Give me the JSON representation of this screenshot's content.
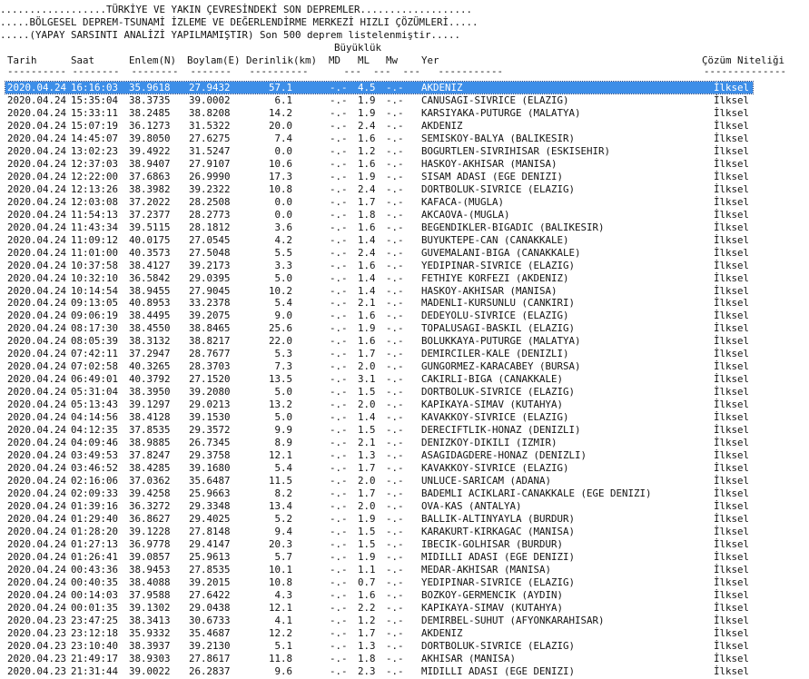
{
  "header": {
    "line1": "..................TÜRKİYE VE YAKIN ÇEVRESİNDEKİ SON DEPREMLER...................",
    "line2": ".....BÖLGESEL DEPREM-TSUNAMİ İZLEME VE DEĞERLENDİRME MERKEZİ HIZLI ÇÖZÜMLERİ.....",
    "line3": ".....(YAPAY SARSINTI ANALİZİ YAPILMAMIŞTIR) Son 500 deprem listelenmiştir.....",
    "magnitude_group": "Büyüklük"
  },
  "columns": {
    "date": "Tarih",
    "time": "Saat",
    "lat": "Enlem(N)",
    "lon": "Boylam(E)",
    "depth": "Derinlik(km)",
    "md": "MD",
    "ml": "ML",
    "mw": "Mw",
    "place": "Yer",
    "quality": "Çözüm Niteliği"
  },
  "colors": {
    "selection": "#3d8ee8",
    "text": "#111111"
  },
  "rows": [
    {
      "date": "2020.04.24",
      "time": "16:16:03",
      "lat": "35.9618",
      "lon": "27.9432",
      "depth": "57.1",
      "md": "-.-",
      "ml": "4.5",
      "mw": "-.-",
      "place": "AKDENIZ",
      "quality": "İlksel"
    },
    {
      "date": "2020.04.24",
      "time": "15:35:04",
      "lat": "38.3735",
      "lon": "39.0002",
      "depth": "6.1",
      "md": "-.-",
      "ml": "1.9",
      "mw": "-.-",
      "place": "CANUSAGI-SIVRICE (ELAZIG)",
      "quality": "İlksel"
    },
    {
      "date": "2020.04.24",
      "time": "15:33:11",
      "lat": "38.2485",
      "lon": "38.8208",
      "depth": "14.2",
      "md": "-.-",
      "ml": "1.9",
      "mw": "-.-",
      "place": "KARSIYAKA-PUTURGE (MALATYA)",
      "quality": "İlksel"
    },
    {
      "date": "2020.04.24",
      "time": "15:07:19",
      "lat": "36.1273",
      "lon": "31.5322",
      "depth": "20.0",
      "md": "-.-",
      "ml": "2.4",
      "mw": "-.-",
      "place": "AKDENIZ",
      "quality": "İlksel"
    },
    {
      "date": "2020.04.24",
      "time": "14:45:07",
      "lat": "39.8050",
      "lon": "27.6275",
      "depth": "7.4",
      "md": "-.-",
      "ml": "1.6",
      "mw": "-.-",
      "place": "SEMISKOY-BALYA (BALIKESIR)",
      "quality": "İlksel"
    },
    {
      "date": "2020.04.24",
      "time": "13:02:23",
      "lat": "39.4922",
      "lon": "31.5247",
      "depth": "0.0",
      "md": "-.-",
      "ml": "1.2",
      "mw": "-.-",
      "place": "BOGURTLEN-SIVRIHISAR (ESKISEHIR)",
      "quality": "İlksel"
    },
    {
      "date": "2020.04.24",
      "time": "12:37:03",
      "lat": "38.9407",
      "lon": "27.9107",
      "depth": "10.6",
      "md": "-.-",
      "ml": "1.6",
      "mw": "-.-",
      "place": "HASKOY-AKHISAR (MANISA)",
      "quality": "İlksel"
    },
    {
      "date": "2020.04.24",
      "time": "12:22:00",
      "lat": "37.6863",
      "lon": "26.9990",
      "depth": "17.3",
      "md": "-.-",
      "ml": "1.9",
      "mw": "-.-",
      "place": "SISAM ADASI (EGE DENIZI)",
      "quality": "İlksel"
    },
    {
      "date": "2020.04.24",
      "time": "12:13:26",
      "lat": "38.3982",
      "lon": "39.2322",
      "depth": "10.8",
      "md": "-.-",
      "ml": "2.4",
      "mw": "-.-",
      "place": "DORTBOLUK-SIVRICE (ELAZIG)",
      "quality": "İlksel"
    },
    {
      "date": "2020.04.24",
      "time": "12:03:08",
      "lat": "37.2022",
      "lon": "28.2508",
      "depth": "0.0",
      "md": "-.-",
      "ml": "1.7",
      "mw": "-.-",
      "place": "KAFACA-(MUGLA)",
      "quality": "İlksel"
    },
    {
      "date": "2020.04.24",
      "time": "11:54:13",
      "lat": "37.2377",
      "lon": "28.2773",
      "depth": "0.0",
      "md": "-.-",
      "ml": "1.8",
      "mw": "-.-",
      "place": "AKCAOVA-(MUGLA)",
      "quality": "İlksel"
    },
    {
      "date": "2020.04.24",
      "time": "11:43:34",
      "lat": "39.5115",
      "lon": "28.1812",
      "depth": "3.6",
      "md": "-.-",
      "ml": "1.6",
      "mw": "-.-",
      "place": "BEGENDIKLER-BIGADIC (BALIKESIR)",
      "quality": "İlksel"
    },
    {
      "date": "2020.04.24",
      "time": "11:09:12",
      "lat": "40.0175",
      "lon": "27.0545",
      "depth": "4.2",
      "md": "-.-",
      "ml": "1.4",
      "mw": "-.-",
      "place": "BUYUKTEPE-CAN (CANAKKALE)",
      "quality": "İlksel"
    },
    {
      "date": "2020.04.24",
      "time": "11:01:00",
      "lat": "40.3573",
      "lon": "27.5048",
      "depth": "5.5",
      "md": "-.-",
      "ml": "2.4",
      "mw": "-.-",
      "place": "GUVEMALANI-BIGA (CANAKKALE)",
      "quality": "İlksel"
    },
    {
      "date": "2020.04.24",
      "time": "10:37:58",
      "lat": "38.4127",
      "lon": "39.2173",
      "depth": "3.3",
      "md": "-.-",
      "ml": "1.6",
      "mw": "-.-",
      "place": "YEDIPINAR-SIVRICE (ELAZIG)",
      "quality": "İlksel"
    },
    {
      "date": "2020.04.24",
      "time": "10:32:10",
      "lat": "36.5842",
      "lon": "29.0395",
      "depth": "5.0",
      "md": "-.-",
      "ml": "1.4",
      "mw": "-.-",
      "place": "FETHIYE KORFEZI (AKDENIZ)",
      "quality": "İlksel"
    },
    {
      "date": "2020.04.24",
      "time": "10:14:54",
      "lat": "38.9455",
      "lon": "27.9045",
      "depth": "10.2",
      "md": "-.-",
      "ml": "1.4",
      "mw": "-.-",
      "place": "HASKOY-AKHISAR (MANISA)",
      "quality": "İlksel"
    },
    {
      "date": "2020.04.24",
      "time": "09:13:05",
      "lat": "40.8953",
      "lon": "33.2378",
      "depth": "5.4",
      "md": "-.-",
      "ml": "2.1",
      "mw": "-.-",
      "place": "MADENLI-KURSUNLU (CANKIRI)",
      "quality": "İlksel"
    },
    {
      "date": "2020.04.24",
      "time": "09:06:19",
      "lat": "38.4495",
      "lon": "39.2075",
      "depth": "9.0",
      "md": "-.-",
      "ml": "1.6",
      "mw": "-.-",
      "place": "DEDEYOLU-SIVRICE (ELAZIG)",
      "quality": "İlksel"
    },
    {
      "date": "2020.04.24",
      "time": "08:17:30",
      "lat": "38.4550",
      "lon": "38.8465",
      "depth": "25.6",
      "md": "-.-",
      "ml": "1.9",
      "mw": "-.-",
      "place": "TOPALUSAGI-BASKIL (ELAZIG)",
      "quality": "İlksel"
    },
    {
      "date": "2020.04.24",
      "time": "08:05:39",
      "lat": "38.3132",
      "lon": "38.8217",
      "depth": "22.0",
      "md": "-.-",
      "ml": "1.6",
      "mw": "-.-",
      "place": "BOLUKKAYA-PUTURGE (MALATYA)",
      "quality": "İlksel"
    },
    {
      "date": "2020.04.24",
      "time": "07:42:11",
      "lat": "37.2947",
      "lon": "28.7677",
      "depth": "5.3",
      "md": "-.-",
      "ml": "1.7",
      "mw": "-.-",
      "place": "DEMIRCILER-KALE (DENIZLI)",
      "quality": "İlksel"
    },
    {
      "date": "2020.04.24",
      "time": "07:02:58",
      "lat": "40.3265",
      "lon": "28.3703",
      "depth": "7.3",
      "md": "-.-",
      "ml": "2.0",
      "mw": "-.-",
      "place": "GUNGORMEZ-KARACABEY (BURSA)",
      "quality": "İlksel"
    },
    {
      "date": "2020.04.24",
      "time": "06:49:01",
      "lat": "40.3792",
      "lon": "27.1520",
      "depth": "13.5",
      "md": "-.-",
      "ml": "3.1",
      "mw": "-.-",
      "place": "CAKIRLI-BIGA (CANAKKALE)",
      "quality": "İlksel"
    },
    {
      "date": "2020.04.24",
      "time": "05:31:04",
      "lat": "38.3950",
      "lon": "39.2080",
      "depth": "5.0",
      "md": "-.-",
      "ml": "1.5",
      "mw": "-.-",
      "place": "DORTBOLUK-SIVRICE (ELAZIG)",
      "quality": "İlksel"
    },
    {
      "date": "2020.04.24",
      "time": "05:13:43",
      "lat": "39.1297",
      "lon": "29.0213",
      "depth": "13.2",
      "md": "-.-",
      "ml": "2.0",
      "mw": "-.-",
      "place": "KAPIKAYA-SIMAV (KUTAHYA)",
      "quality": "İlksel"
    },
    {
      "date": "2020.04.24",
      "time": "04:14:56",
      "lat": "38.4128",
      "lon": "39.1530",
      "depth": "5.0",
      "md": "-.-",
      "ml": "1.4",
      "mw": "-.-",
      "place": "KAVAKKOY-SIVRICE (ELAZIG)",
      "quality": "İlksel"
    },
    {
      "date": "2020.04.24",
      "time": "04:12:35",
      "lat": "37.8535",
      "lon": "29.3572",
      "depth": "9.9",
      "md": "-.-",
      "ml": "1.5",
      "mw": "-.-",
      "place": "DERECIFTLIK-HONAZ (DENIZLI)",
      "quality": "İlksel"
    },
    {
      "date": "2020.04.24",
      "time": "04:09:46",
      "lat": "38.9885",
      "lon": "26.7345",
      "depth": "8.9",
      "md": "-.-",
      "ml": "2.1",
      "mw": "-.-",
      "place": "DENIZKOY-DIKILI (IZMIR)",
      "quality": "İlksel"
    },
    {
      "date": "2020.04.24",
      "time": "03:49:53",
      "lat": "37.8247",
      "lon": "29.3758",
      "depth": "12.1",
      "md": "-.-",
      "ml": "1.3",
      "mw": "-.-",
      "place": "ASAGIDAGDERE-HONAZ (DENIZLI)",
      "quality": "İlksel"
    },
    {
      "date": "2020.04.24",
      "time": "03:46:52",
      "lat": "38.4285",
      "lon": "39.1680",
      "depth": "5.4",
      "md": "-.-",
      "ml": "1.7",
      "mw": "-.-",
      "place": "KAVAKKOY-SIVRICE (ELAZIG)",
      "quality": "İlksel"
    },
    {
      "date": "2020.04.24",
      "time": "02:16:06",
      "lat": "37.0362",
      "lon": "35.6487",
      "depth": "11.5",
      "md": "-.-",
      "ml": "2.0",
      "mw": "-.-",
      "place": "UNLUCE-SARICAM (ADANA)",
      "quality": "İlksel"
    },
    {
      "date": "2020.04.24",
      "time": "02:09:33",
      "lat": "39.4258",
      "lon": "25.9663",
      "depth": "8.2",
      "md": "-.-",
      "ml": "1.7",
      "mw": "-.-",
      "place": "BADEMLI ACIKLARI-CANAKKALE (EGE DENIZI)",
      "quality": "İlksel"
    },
    {
      "date": "2020.04.24",
      "time": "01:39:16",
      "lat": "36.3272",
      "lon": "29.3348",
      "depth": "13.4",
      "md": "-.-",
      "ml": "2.0",
      "mw": "-.-",
      "place": "OVA-KAS (ANTALYA)",
      "quality": "İlksel"
    },
    {
      "date": "2020.04.24",
      "time": "01:29:40",
      "lat": "36.8627",
      "lon": "29.4025",
      "depth": "5.2",
      "md": "-.-",
      "ml": "1.9",
      "mw": "-.-",
      "place": "BALLIK-ALTINYAYLA (BURDUR)",
      "quality": "İlksel"
    },
    {
      "date": "2020.04.24",
      "time": "01:28:20",
      "lat": "39.1228",
      "lon": "27.8148",
      "depth": "9.4",
      "md": "-.-",
      "ml": "1.5",
      "mw": "-.-",
      "place": "KARAKURT-KIRKAGAC (MANISA)",
      "quality": "İlksel"
    },
    {
      "date": "2020.04.24",
      "time": "01:27:13",
      "lat": "36.9778",
      "lon": "29.4147",
      "depth": "20.3",
      "md": "-.-",
      "ml": "1.5",
      "mw": "-.-",
      "place": "IBECIK-GOLHISAR (BURDUR)",
      "quality": "İlksel"
    },
    {
      "date": "2020.04.24",
      "time": "01:26:41",
      "lat": "39.0857",
      "lon": "25.9613",
      "depth": "5.7",
      "md": "-.-",
      "ml": "1.9",
      "mw": "-.-",
      "place": "MIDILLI ADASI (EGE DENIZI)",
      "quality": "İlksel"
    },
    {
      "date": "2020.04.24",
      "time": "00:43:36",
      "lat": "38.9453",
      "lon": "27.8535",
      "depth": "10.1",
      "md": "-.-",
      "ml": "1.1",
      "mw": "-.-",
      "place": "MEDAR-AKHISAR (MANISA)",
      "quality": "İlksel"
    },
    {
      "date": "2020.04.24",
      "time": "00:40:35",
      "lat": "38.4088",
      "lon": "39.2015",
      "depth": "10.8",
      "md": "-.-",
      "ml": "0.7",
      "mw": "-.-",
      "place": "YEDIPINAR-SIVRICE (ELAZIG)",
      "quality": "İlksel"
    },
    {
      "date": "2020.04.24",
      "time": "00:14:03",
      "lat": "37.9588",
      "lon": "27.6422",
      "depth": "4.3",
      "md": "-.-",
      "ml": "1.6",
      "mw": "-.-",
      "place": "BOZKOY-GERMENCIK (AYDIN)",
      "quality": "İlksel"
    },
    {
      "date": "2020.04.24",
      "time": "00:01:35",
      "lat": "39.1302",
      "lon": "29.0438",
      "depth": "12.1",
      "md": "-.-",
      "ml": "2.2",
      "mw": "-.-",
      "place": "KAPIKAYA-SIMAV (KUTAHYA)",
      "quality": "İlksel"
    },
    {
      "date": "2020.04.23",
      "time": "23:47:25",
      "lat": "38.3413",
      "lon": "30.6733",
      "depth": "4.1",
      "md": "-.-",
      "ml": "1.2",
      "mw": "-.-",
      "place": "DEMIRBEL-SUHUT (AFYONKARAHISAR)",
      "quality": "İlksel"
    },
    {
      "date": "2020.04.23",
      "time": "23:12:18",
      "lat": "35.9332",
      "lon": "35.4687",
      "depth": "12.2",
      "md": "-.-",
      "ml": "1.7",
      "mw": "-.-",
      "place": "AKDENIZ",
      "quality": "İlksel"
    },
    {
      "date": "2020.04.23",
      "time": "23:10:40",
      "lat": "38.3937",
      "lon": "39.2130",
      "depth": "5.1",
      "md": "-.-",
      "ml": "1.3",
      "mw": "-.-",
      "place": "DORTBOLUK-SIVRICE (ELAZIG)",
      "quality": "İlksel"
    },
    {
      "date": "2020.04.23",
      "time": "21:49:17",
      "lat": "38.9303",
      "lon": "27.8617",
      "depth": "11.8",
      "md": "-.-",
      "ml": "1.8",
      "mw": "-.-",
      "place": "AKHISAR (MANISA)",
      "quality": "İlksel"
    },
    {
      "date": "2020.04.23",
      "time": "21:31:44",
      "lat": "39.0022",
      "lon": "26.2837",
      "depth": "9.6",
      "md": "-.-",
      "ml": "2.3",
      "mw": "-.-",
      "place": "MIDILLI ADASI (EGE DENIZI)",
      "quality": "İlksel"
    }
  ]
}
